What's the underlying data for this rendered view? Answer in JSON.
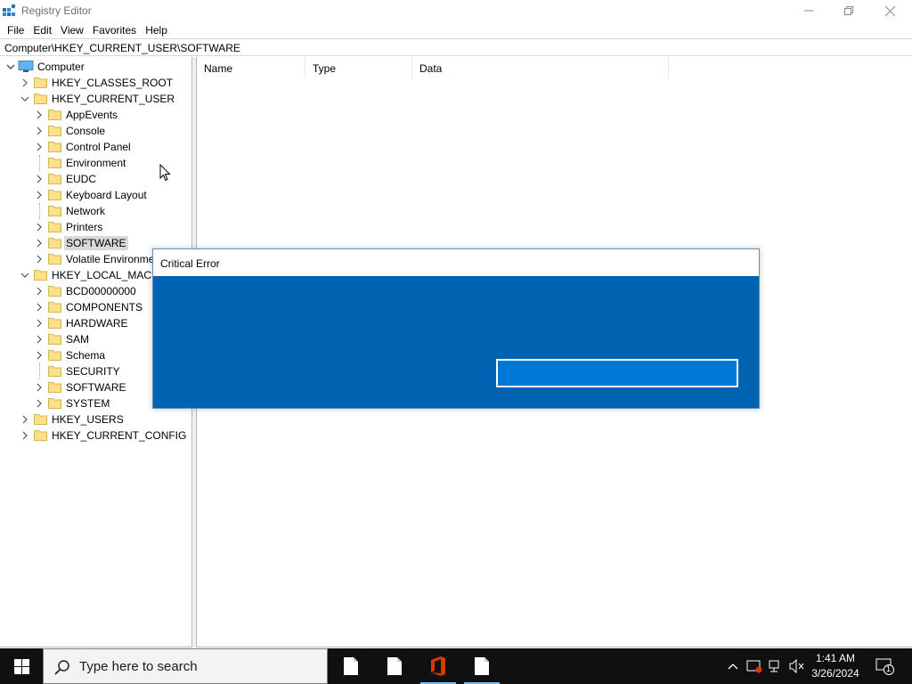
{
  "window": {
    "title": "Registry Editor"
  },
  "menu": [
    "File",
    "Edit",
    "View",
    "Favorites",
    "Help"
  ],
  "address": "Computer\\HKEY_CURRENT_USER\\SOFTWARE",
  "tree": {
    "root": "Computer",
    "hives": {
      "classes_root": "HKEY_CLASSES_ROOT",
      "current_user": "HKEY_CURRENT_USER",
      "local_machine": "HKEY_LOCAL_MACH",
      "users": "HKEY_USERS",
      "current_config": "HKEY_CURRENT_CONFIG"
    },
    "current_user_children": [
      "AppEvents",
      "Console",
      "Control Panel",
      "Environment",
      "EUDC",
      "Keyboard Layout",
      "Network",
      "Printers",
      "SOFTWARE",
      "Volatile Environme"
    ],
    "local_machine_children": [
      "BCD00000000",
      "COMPONENTS",
      "HARDWARE",
      "SAM",
      "Schema",
      "SECURITY",
      "SOFTWARE",
      "SYSTEM"
    ],
    "selected": "SOFTWARE"
  },
  "list": {
    "columns": [
      "Name",
      "Type",
      "Data"
    ]
  },
  "dialog": {
    "title": "Critical Error",
    "button_label": ""
  },
  "taskbar": {
    "search_placeholder": "Type here to search",
    "time": "1:41 AM",
    "date": "3/26/2024",
    "notification_count": "1"
  },
  "colors": {
    "dialog_bg": "#0063b1",
    "dialog_button": "#0078d7",
    "taskbar": "#101010",
    "office_red": "#d83b01"
  }
}
